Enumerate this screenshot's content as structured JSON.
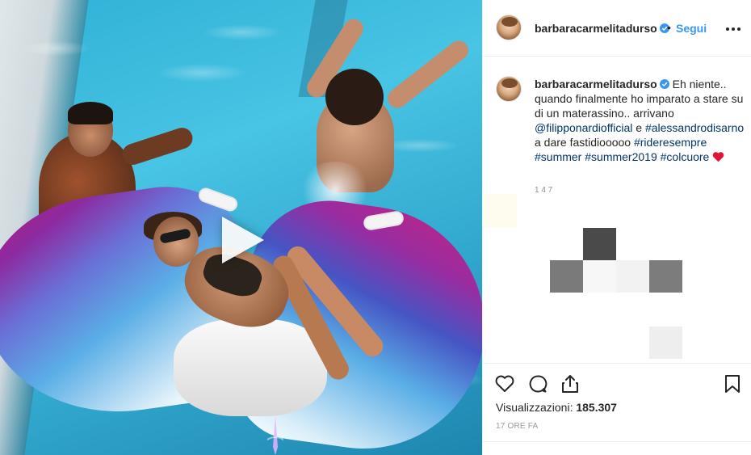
{
  "post": {
    "username": "barbaracarmelitadurso",
    "verified": true,
    "dot": "•",
    "follow_label": "Segui",
    "more_icon": "more-horizontal-icon"
  },
  "caption": {
    "username": "barbaracarmelitadurso",
    "text_1": "Eh niente.. quando finalmente ho imparato a stare su di un materassino.. arrivano ",
    "mention_1": "@filipponardiofficial",
    "text_2": " e ",
    "hashtag_1": "#alessandrodisarno",
    "text_3": " a dare fastidiooooo ",
    "hashtag_2": "#rideresempre",
    "hashtag_3": "#summer",
    "hashtag_4": "#summer2019",
    "hashtag_5": "#colcuore",
    "emoji": "red-heart-icon",
    "cut_off_text": "1 4 7"
  },
  "media": {
    "type": "video",
    "play_icon": "play-icon"
  },
  "actions": {
    "like_icon": "heart-outline-icon",
    "comment_icon": "comment-bubble-icon",
    "share_icon": "share-icon",
    "save_icon": "bookmark-icon"
  },
  "stats": {
    "views_label": "Visualizzazioni:",
    "views_value": "185.307",
    "time": "17 ORE FA"
  },
  "colors": {
    "link_blue": "#3897f0",
    "hashtag_blue": "#003569",
    "text": "#262626",
    "muted": "#999999",
    "border": "#efefef"
  }
}
